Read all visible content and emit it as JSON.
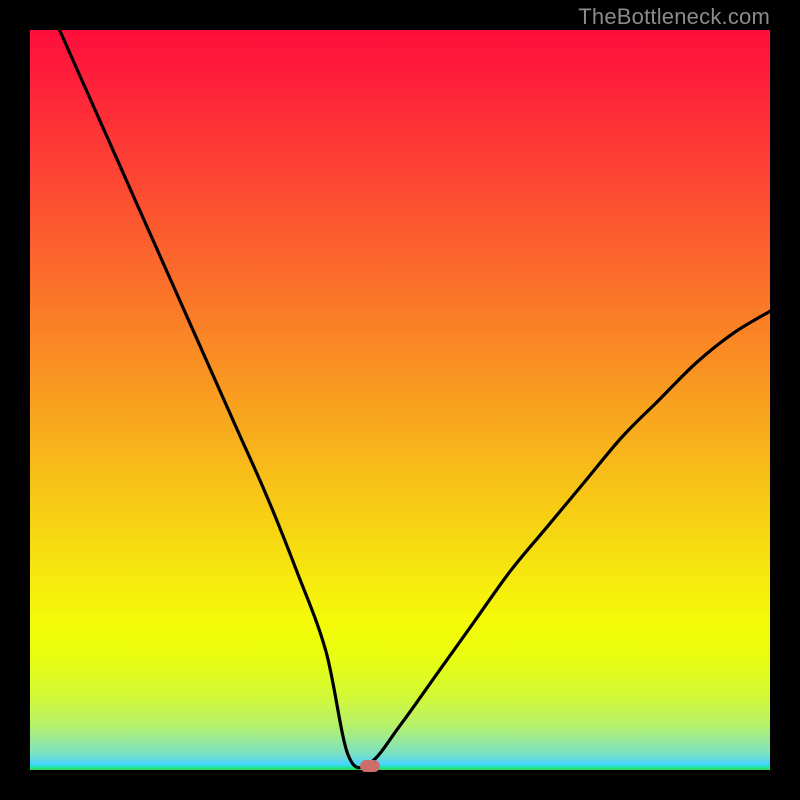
{
  "attribution": "TheBottleneck.com",
  "colors": {
    "frame": "#000000",
    "curve": "#000000",
    "marker": "#CC6F6B",
    "gradient_top": "#FE0E3B",
    "gradient_mid": "#F7C716",
    "gradient_bottom": "#35D749"
  },
  "chart_data": {
    "type": "line",
    "title": "",
    "xlabel": "",
    "ylabel": "",
    "xlim": [
      0,
      100
    ],
    "ylim": [
      0,
      100
    ],
    "note": "V-shaped bottleneck curve. x is relative component strength; y is bottleneck percentage. Minimum (≈0%) around x≈43–46. Left branch starts near (4,100); right branch ends near (100,62).",
    "series": [
      {
        "name": "bottleneck-curve",
        "x": [
          4,
          8,
          12,
          16,
          20,
          24,
          28,
          32,
          36,
          40,
          43,
          46,
          50,
          55,
          60,
          65,
          70,
          75,
          80,
          85,
          90,
          95,
          100
        ],
        "y": [
          100,
          91,
          82,
          73,
          64,
          55,
          46,
          37,
          27,
          16,
          2,
          1,
          6,
          13,
          20,
          27,
          33,
          39,
          45,
          50,
          55,
          59,
          62
        ]
      }
    ],
    "marker": {
      "x": 46,
      "y": 0.5
    }
  }
}
